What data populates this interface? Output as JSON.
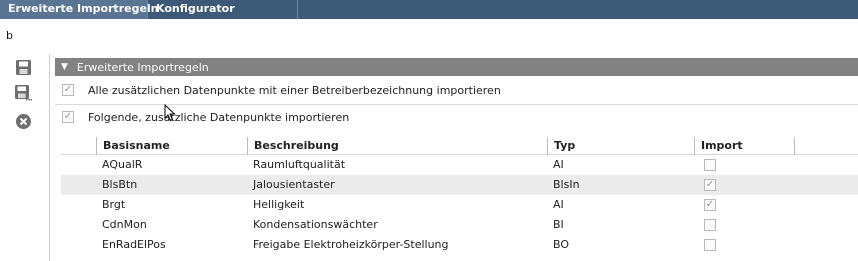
{
  "tabs": [
    {
      "label": "Erweiterte Importregeln",
      "active": true
    },
    {
      "label": "Konfigurator",
      "active": false
    }
  ],
  "breadcrumb": "b",
  "toolbar": {
    "icons": [
      "save-icon",
      "save-as-icon",
      "close-circle-icon"
    ]
  },
  "panel": {
    "title": "Erweiterte Importregeln",
    "option1": {
      "label": "Alle zusätzlichen Datenpunkte mit einer Betreiberbezeichnung importieren",
      "checked": true
    },
    "option2": {
      "label": "Folgende, zusätzliche Datenpunkte importieren",
      "checked": true
    }
  },
  "table": {
    "headers": {
      "basisname": "Basisname",
      "beschreibung": "Beschreibung",
      "typ": "Typ",
      "import": "Import"
    },
    "rows": [
      {
        "basisname": "AQualR",
        "beschreibung": "Raumluftqualität",
        "typ": "AI",
        "import": false
      },
      {
        "basisname": "BlsBtn",
        "beschreibung": "Jalousientaster",
        "typ": "BlsIn",
        "import": true
      },
      {
        "basisname": "Brgt",
        "beschreibung": "Helligkeit",
        "typ": "AI",
        "import": true
      },
      {
        "basisname": "CdnMon",
        "beschreibung": "Kondensationswächter",
        "typ": "BI",
        "import": false
      },
      {
        "basisname": "EnRadElPos",
        "beschreibung": "Freigabe Elektroheizkörper-Stellung",
        "typ": "BO",
        "import": false
      }
    ]
  },
  "colors": {
    "tabbar": "#3d5978",
    "panel_header": "#828282",
    "row_alt": "#ebebeb"
  }
}
